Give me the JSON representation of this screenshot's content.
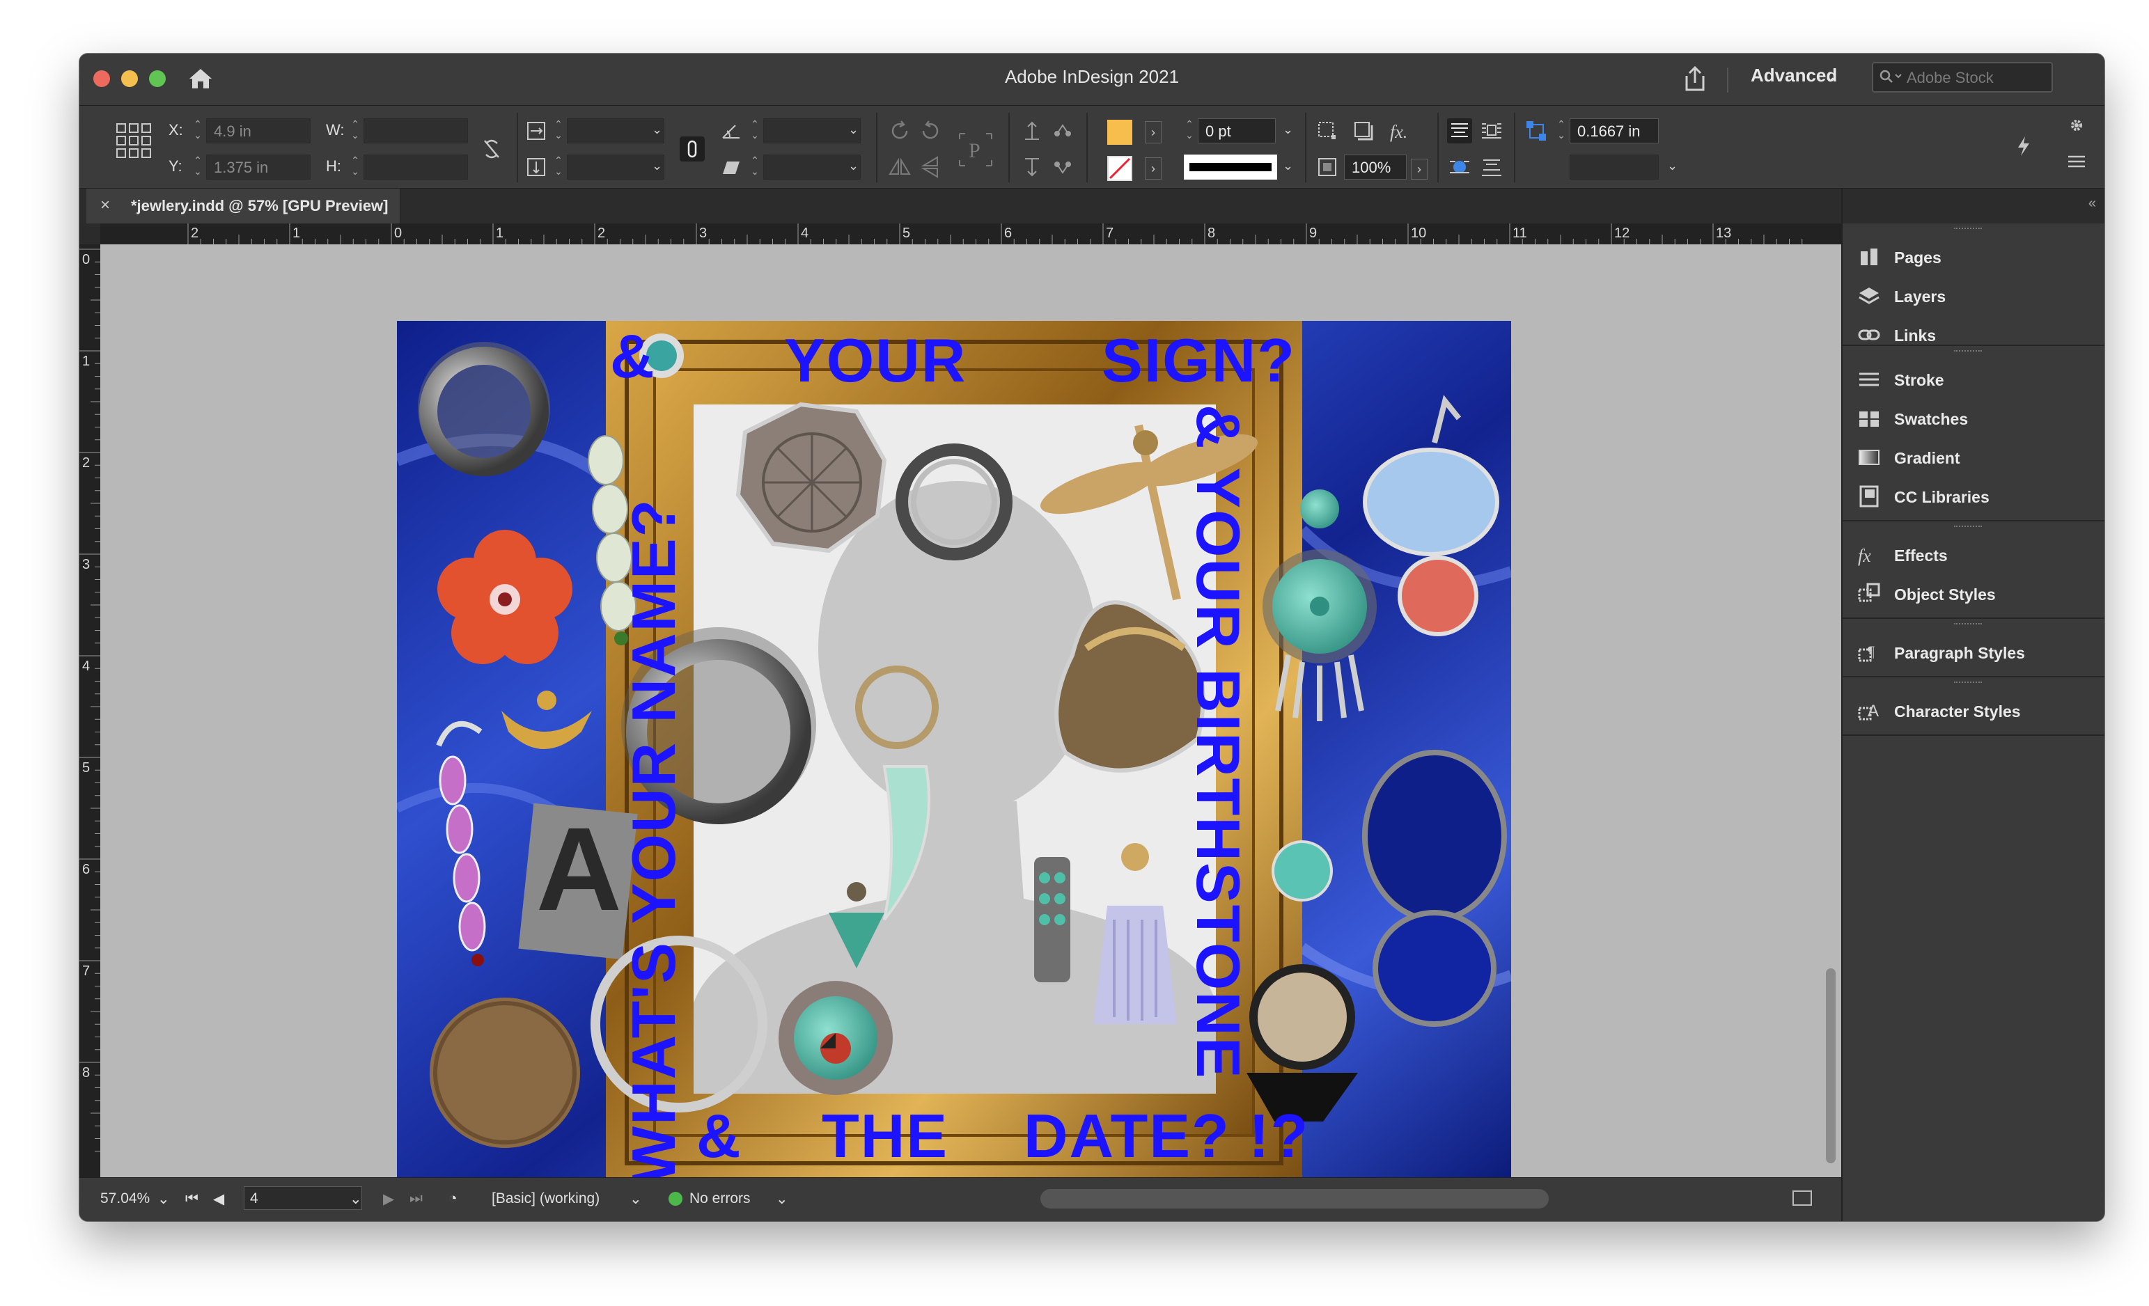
{
  "window": {
    "title": "Adobe InDesign 2021",
    "workspace": "Advanced",
    "stock_placeholder": "Adobe Stock"
  },
  "control": {
    "x_label": "X:",
    "x_value": "4.9 in",
    "y_label": "Y:",
    "y_value": "1.375 in",
    "w_label": "W:",
    "h_label": "H:",
    "stroke_weight": "0 pt",
    "opacity": "100%",
    "gap_value": "0.1667 in"
  },
  "document": {
    "tab_label": "*jewlery.indd @ 57% [GPU Preview]"
  },
  "rulers": {
    "top": [
      "2",
      "1",
      "0",
      "1",
      "2",
      "3",
      "4",
      "5",
      "6",
      "7",
      "8",
      "9",
      "10",
      "11",
      "12",
      "13"
    ],
    "left": [
      "0",
      "1",
      "2",
      "3",
      "4",
      "5",
      "6",
      "7",
      "8"
    ]
  },
  "artwork": {
    "top_left": "YOUR",
    "top_right": "SIGN?",
    "right_side": "& YOUR BIRTHSTONE",
    "left_side": "WHAT'S YOUR NAME?",
    "left_corner": "&",
    "bottom_amp": "&",
    "bottom_the": "THE",
    "bottom_date": "DATE? !?",
    "letter_tile": "A",
    "text_color": "#1d14ff",
    "velvet_color": "#1b2e9c",
    "frame_color": "#b8862a"
  },
  "status": {
    "zoom": "57.04%",
    "page": "4",
    "preflight_profile": "[Basic] (working)",
    "errors": "No errors"
  },
  "panels": {
    "group1": [
      "Pages",
      "Layers",
      "Links"
    ],
    "group2": [
      "Stroke",
      "Swatches",
      "Gradient",
      "CC Libraries"
    ],
    "group3": [
      "Effects",
      "Object Styles"
    ],
    "group4": [
      "Paragraph Styles"
    ],
    "group5": [
      "Character Styles"
    ]
  }
}
